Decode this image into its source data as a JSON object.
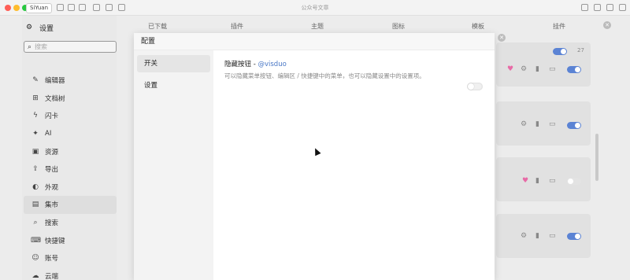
{
  "titlebar": {
    "workspace": "SiYuan",
    "title": "公众号文章"
  },
  "settings_nav": {
    "header": "设置",
    "search_placeholder": "搜索",
    "items": [
      {
        "label": "编辑器",
        "icon": "pencil-icon"
      },
      {
        "label": "文档树",
        "icon": "tree-icon"
      },
      {
        "label": "闪卡",
        "icon": "flash-icon"
      },
      {
        "label": "AI",
        "icon": "ai-icon"
      },
      {
        "label": "资源",
        "icon": "image-icon"
      },
      {
        "label": "导出",
        "icon": "export-icon"
      },
      {
        "label": "外观",
        "icon": "palette-icon"
      },
      {
        "label": "集市",
        "icon": "store-icon"
      },
      {
        "label": "搜索",
        "icon": "search-icon"
      },
      {
        "label": "快捷键",
        "icon": "keyboard-icon"
      },
      {
        "label": "账号",
        "icon": "user-icon"
      },
      {
        "label": "云端",
        "icon": "cloud-icon"
      }
    ],
    "active": "集市"
  },
  "bazaar_tabs": [
    "已下载",
    "插件",
    "主题",
    "图标",
    "模板",
    "挂件"
  ],
  "dialog": {
    "title": "配置",
    "side_items": [
      "开关",
      "设置"
    ],
    "active_side": "开关",
    "option": {
      "title": "隐藏按钮 - ",
      "author": "@visduo",
      "description": "可以隐藏菜单按钮、编辑区 / 快捷键中的菜单，也可以隐藏设置中的设置项。",
      "enabled": false
    }
  },
  "bg_count": "27",
  "colors": {
    "accent": "#5b83d4",
    "link": "#4a78c6",
    "heart": "#e86aa6"
  }
}
